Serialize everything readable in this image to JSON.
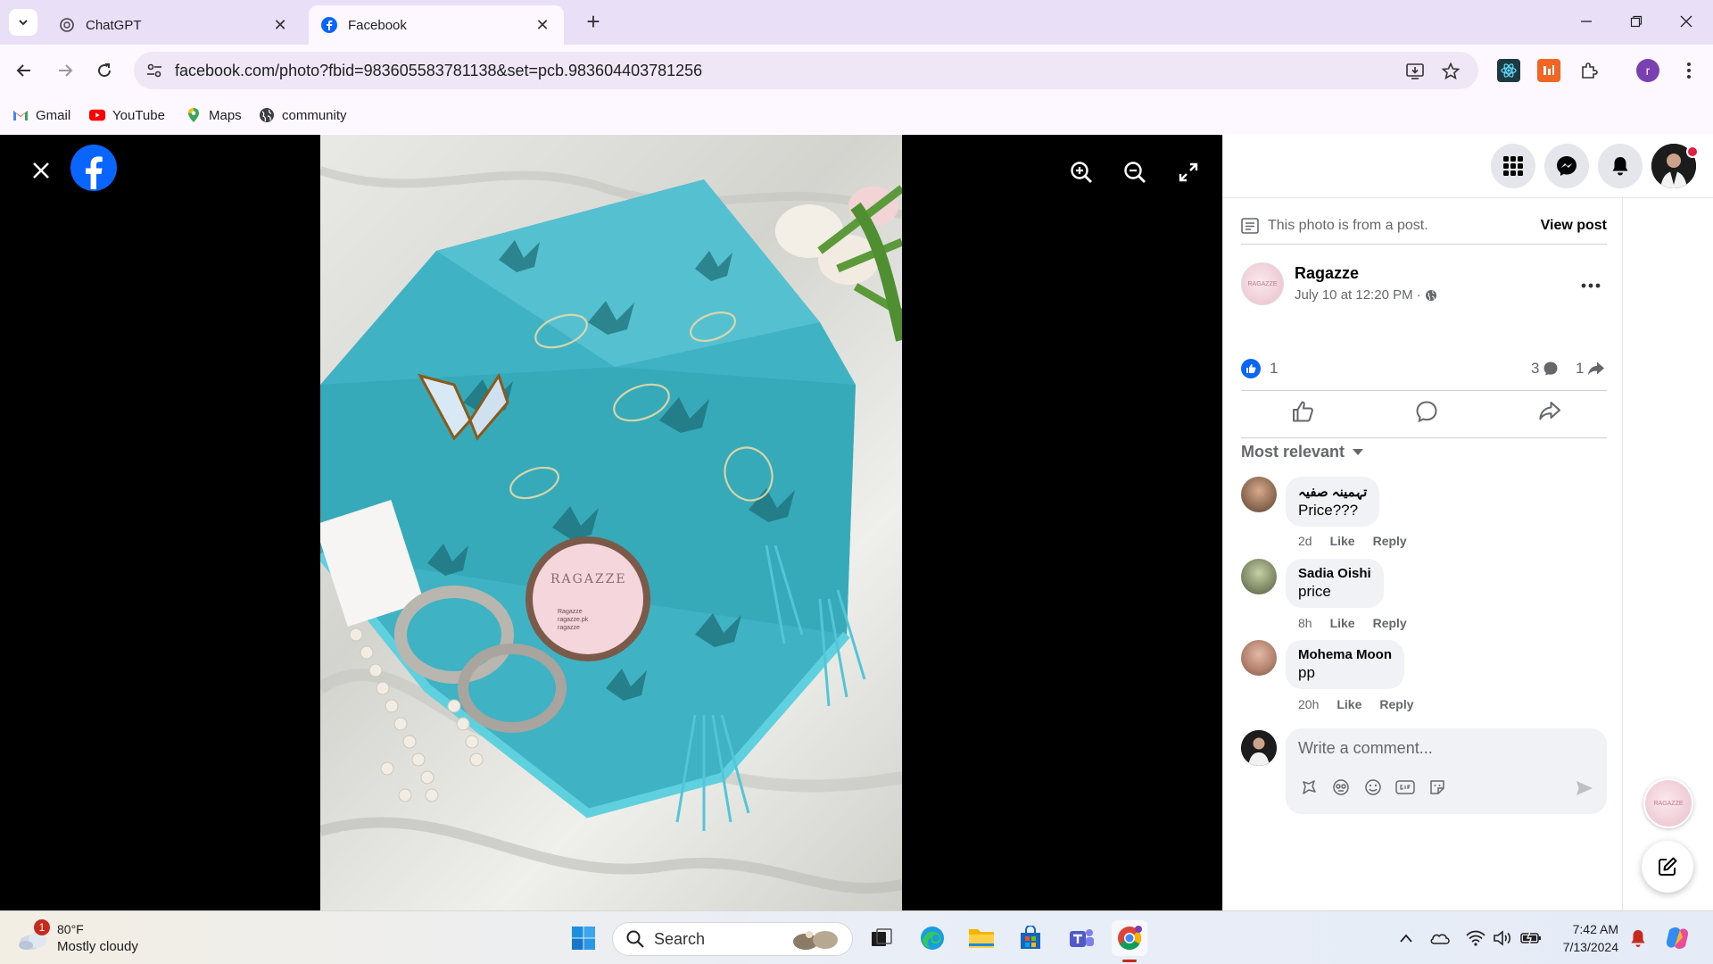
{
  "browser": {
    "tabs": [
      {
        "title": "ChatGPT",
        "active": false
      },
      {
        "title": "Facebook",
        "active": true
      }
    ],
    "url": "facebook.com/photo?fbid=983605583781138&set=pcb.983604403781256",
    "bookmarks": [
      {
        "label": "Gmail",
        "icon": "gmail-icon"
      },
      {
        "label": "YouTube",
        "icon": "youtube-icon"
      },
      {
        "label": "Maps",
        "icon": "maps-icon"
      },
      {
        "label": "community",
        "icon": "globe-icon"
      }
    ],
    "profile_initial": "r"
  },
  "photo": {
    "coaster_brand": "RAGAZZE",
    "coaster_lines": [
      "Ragazze",
      "ragazze.pk",
      "ragazze"
    ]
  },
  "panel": {
    "post_note": "This photo is from a post.",
    "view_post": "View post",
    "author": {
      "name": "Ragazze",
      "time": "July 10 at 12:20 PM",
      "avatar_text": "RAGAZZE"
    },
    "reactions": {
      "likes": "1",
      "comments": "3",
      "shares": "1"
    },
    "sort_label": "Most relevant",
    "comments": [
      {
        "name": "تہمینہ صفیہ",
        "text": "Price???",
        "time": "2d",
        "like": "Like",
        "reply": "Reply"
      },
      {
        "name": "Sadia Oishi",
        "text": "price",
        "time": "8h",
        "like": "Like",
        "reply": "Reply"
      },
      {
        "name": "Mohema Moon",
        "text": "pp",
        "time": "20h",
        "like": "Like",
        "reply": "Reply"
      }
    ],
    "write_placeholder": "Write a comment..."
  },
  "taskbar": {
    "weather": {
      "temp": "80°F",
      "condition": "Mostly cloudy",
      "badge": "1"
    },
    "search_label": "Search",
    "time": "7:42 AM",
    "date": "7/13/2024"
  },
  "colors": {
    "facebook_blue": "#0866ff",
    "viewer_bg": "#000000",
    "tab_strip": "#e9dff7",
    "scarf_teal": "#3fb3c4"
  }
}
